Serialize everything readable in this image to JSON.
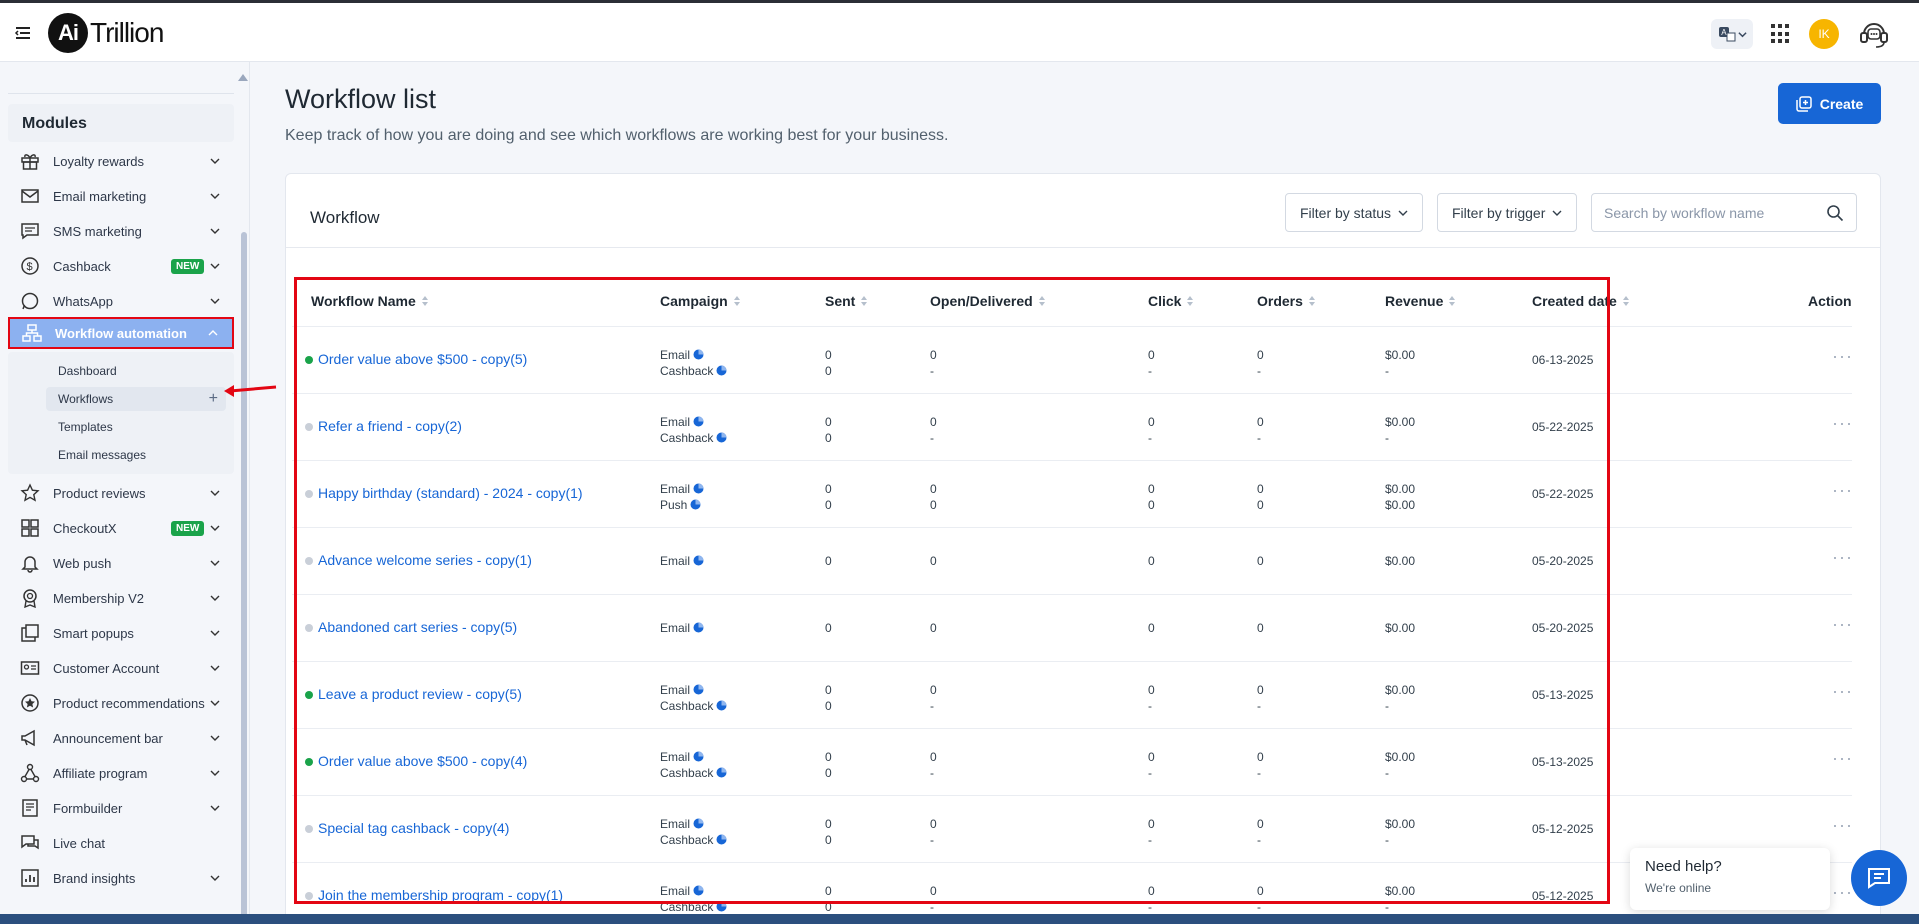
{
  "header": {
    "logo_mark": "Ai",
    "logo_text": "Trillion",
    "avatar_initials": "IK"
  },
  "sidebar": {
    "section_title": "Modules",
    "items": [
      {
        "label": "Loyalty rewards",
        "icon": "gift-icon",
        "badge": ""
      },
      {
        "label": "Email marketing",
        "icon": "mail-icon",
        "badge": ""
      },
      {
        "label": "SMS marketing",
        "icon": "message-icon",
        "badge": ""
      },
      {
        "label": "Cashback",
        "icon": "dollar-circle-icon",
        "badge": "NEW"
      },
      {
        "label": "WhatsApp",
        "icon": "whatsapp-icon",
        "badge": ""
      },
      {
        "label": "Workflow automation",
        "icon": "workflow-icon",
        "badge": "",
        "active": true
      },
      {
        "label": "Product reviews",
        "icon": "star-icon",
        "badge": ""
      },
      {
        "label": "CheckoutX",
        "icon": "checkout-icon",
        "badge": "NEW"
      },
      {
        "label": "Web push",
        "icon": "bell-icon",
        "badge": ""
      },
      {
        "label": "Membership V2",
        "icon": "badge-icon",
        "badge": ""
      },
      {
        "label": "Smart popups",
        "icon": "popup-icon",
        "badge": ""
      },
      {
        "label": "Customer Account",
        "icon": "id-card-icon",
        "badge": ""
      },
      {
        "label": "Product recommendations",
        "icon": "recommend-icon",
        "badge": ""
      },
      {
        "label": "Announcement bar",
        "icon": "megaphone-icon",
        "badge": ""
      },
      {
        "label": "Affiliate program",
        "icon": "network-icon",
        "badge": ""
      },
      {
        "label": "Formbuilder",
        "icon": "form-icon",
        "badge": ""
      },
      {
        "label": "Live chat",
        "icon": "chat-icon",
        "badge": ""
      },
      {
        "label": "Brand insights",
        "icon": "chart-icon",
        "badge": ""
      }
    ],
    "sub_items": [
      {
        "label": "Dashboard"
      },
      {
        "label": "Workflows",
        "active": true
      },
      {
        "label": "Templates"
      },
      {
        "label": "Email messages"
      }
    ]
  },
  "main": {
    "title": "Workflow list",
    "subtitle": "Keep track of how you are doing and see which workflows are working best for your business.",
    "create_label": "Create",
    "card_title": "Workflow",
    "filter_status": "Filter by status",
    "filter_trigger": "Filter by trigger",
    "search_placeholder": "Search by workflow name",
    "columns": [
      "Workflow Name",
      "Campaign",
      "Sent",
      "Open/Delivered",
      "Click",
      "Orders",
      "Revenue",
      "Created date",
      "Action"
    ],
    "rows": [
      {
        "name": "Order value above $500 - copy(5)",
        "active": true,
        "campaigns": [
          "Email",
          "Cashback"
        ],
        "sent": [
          "0",
          "0"
        ],
        "open": [
          "0",
          "-"
        ],
        "click": [
          "0",
          "-"
        ],
        "orders": [
          "0",
          "-"
        ],
        "revenue": [
          "$0.00",
          "-"
        ],
        "date": "06-13-2025"
      },
      {
        "name": "Refer a friend - copy(2)",
        "active": false,
        "campaigns": [
          "Email",
          "Cashback"
        ],
        "sent": [
          "0",
          "0"
        ],
        "open": [
          "0",
          "-"
        ],
        "click": [
          "0",
          "-"
        ],
        "orders": [
          "0",
          "-"
        ],
        "revenue": [
          "$0.00",
          "-"
        ],
        "date": "05-22-2025"
      },
      {
        "name": "Happy birthday (standard) - 2024 - copy(1)",
        "active": false,
        "campaigns": [
          "Email",
          "Push"
        ],
        "sent": [
          "0",
          "0"
        ],
        "open": [
          "0",
          "0"
        ],
        "click": [
          "0",
          "0"
        ],
        "orders": [
          "0",
          "0"
        ],
        "revenue": [
          "$0.00",
          "$0.00"
        ],
        "date": "05-22-2025"
      },
      {
        "name": "Advance welcome series - copy(1)",
        "active": false,
        "campaigns": [
          "Email"
        ],
        "sent": [
          "0"
        ],
        "open": [
          "0"
        ],
        "click": [
          "0"
        ],
        "orders": [
          "0"
        ],
        "revenue": [
          "$0.00"
        ],
        "date": "05-20-2025"
      },
      {
        "name": "Abandoned cart series - copy(5)",
        "active": false,
        "campaigns": [
          "Email"
        ],
        "sent": [
          "0"
        ],
        "open": [
          "0"
        ],
        "click": [
          "0"
        ],
        "orders": [
          "0"
        ],
        "revenue": [
          "$0.00"
        ],
        "date": "05-20-2025"
      },
      {
        "name": "Leave a product review - copy(5)",
        "active": true,
        "campaigns": [
          "Email",
          "Cashback"
        ],
        "sent": [
          "0",
          "0"
        ],
        "open": [
          "0",
          "-"
        ],
        "click": [
          "0",
          "-"
        ],
        "orders": [
          "0",
          "-"
        ],
        "revenue": [
          "$0.00",
          "-"
        ],
        "date": "05-13-2025"
      },
      {
        "name": "Order value above $500 - copy(4)",
        "active": true,
        "campaigns": [
          "Email",
          "Cashback"
        ],
        "sent": [
          "0",
          "0"
        ],
        "open": [
          "0",
          "-"
        ],
        "click": [
          "0",
          "-"
        ],
        "orders": [
          "0",
          "-"
        ],
        "revenue": [
          "$0.00",
          "-"
        ],
        "date": "05-13-2025"
      },
      {
        "name": "Special tag cashback - copy(4)",
        "active": false,
        "campaigns": [
          "Email",
          "Cashback"
        ],
        "sent": [
          "0",
          "0"
        ],
        "open": [
          "0",
          "-"
        ],
        "click": [
          "0",
          "-"
        ],
        "orders": [
          "0",
          "-"
        ],
        "revenue": [
          "$0.00",
          "-"
        ],
        "date": "05-12-2025"
      },
      {
        "name": "Join the membership program - copy(1)",
        "active": false,
        "campaigns": [
          "Email",
          "Cashback"
        ],
        "sent": [
          "0",
          "0"
        ],
        "open": [
          "0",
          "-"
        ],
        "click": [
          "0",
          "-"
        ],
        "orders": [
          "0",
          "-"
        ],
        "revenue": [
          "$0.00",
          "-"
        ],
        "date": "05-12-2025"
      }
    ]
  },
  "chat_widget": {
    "title": "Need help?",
    "status": "We're online"
  },
  "colors": {
    "accent": "#1766d6",
    "active_dot": "#1aa34a",
    "inactive_dot": "#c9cfd8",
    "highlight": "#e30613",
    "new_badge": "#1aa34a"
  }
}
